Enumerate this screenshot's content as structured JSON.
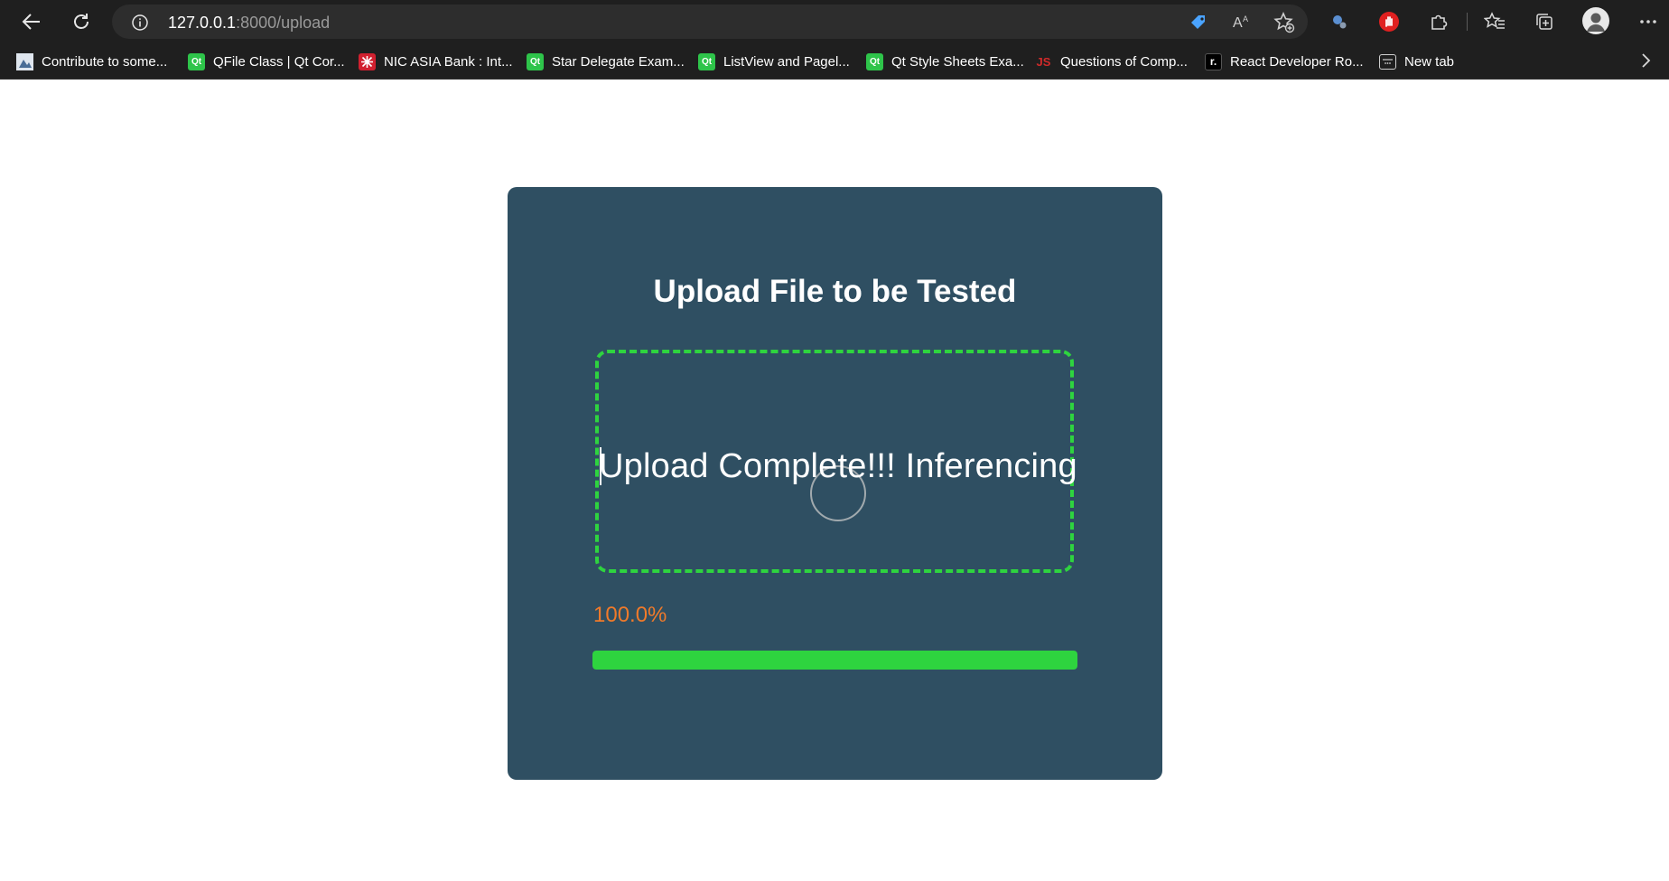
{
  "browser": {
    "url_host": "127.0.0.1",
    "url_rest": ":8000/upload",
    "bookmarks": [
      {
        "label": "Contribute to some...",
        "icon": "profile-favicon"
      },
      {
        "label": "QFile Class | Qt Cor...",
        "icon": "qt-favicon"
      },
      {
        "label": "NIC ASIA Bank : Int...",
        "icon": "nic-asia-favicon"
      },
      {
        "label": "Star Delegate Exam...",
        "icon": "qt-favicon"
      },
      {
        "label": "ListView and Pagel...",
        "icon": "qt-favicon"
      },
      {
        "label": "Qt Style Sheets Exa...",
        "icon": "qt-favicon"
      },
      {
        "label": "Questions of Comp...",
        "icon": "js-favicon"
      },
      {
        "label": "React Developer Ro...",
        "icon": "r-favicon"
      },
      {
        "label": "New tab",
        "icon": "new-tab-favicon"
      }
    ],
    "favicon_text": {
      "qt": "Qt",
      "js": "JS",
      "r": "r."
    }
  },
  "page": {
    "title": "Upload File to be Tested",
    "status_text": "Upload Complete!!! Inferencing",
    "progress_text": "100.0%",
    "progress_fraction": 1.0
  },
  "colors": {
    "card_bg": "#2f4f62",
    "accent_green": "#2ed43f",
    "percent_orange": "#f07a2a"
  }
}
